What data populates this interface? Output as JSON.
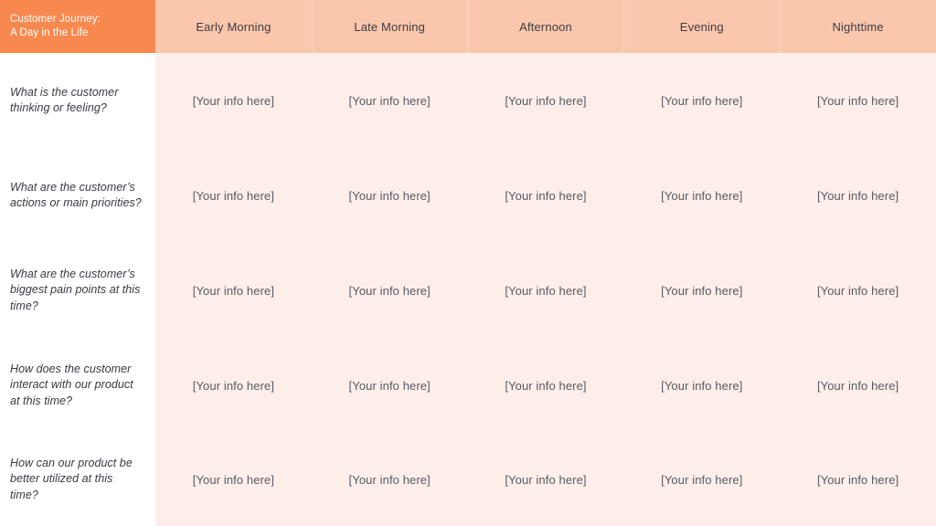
{
  "board": {
    "title_lines": [
      "Customer Journey:",
      "A Day in the Life"
    ],
    "colors": {
      "title_block": "#F8894E",
      "header_band": "#FBC7AC",
      "header_divider": "#FDD5C0",
      "body_cell": "#FDEEEA",
      "label_cell": "#FFFFFF",
      "header_text": "#3C3C41",
      "label_text": "#3A3A40",
      "placeholder_text": "#575B62",
      "title_text": "#FFFFFF"
    },
    "stages": [
      {
        "label": "Early Morning"
      },
      {
        "label": "Late Morning"
      },
      {
        "label": "Afternoon"
      },
      {
        "label": "Evening"
      },
      {
        "label": "Nighttime"
      }
    ],
    "rows": [
      {
        "label": "What is the customer thinking or feeling?",
        "cells": [
          "[Your info here]",
          "[Your info here]",
          "[Your info here]",
          "[Your info here]",
          "[Your info here]"
        ]
      },
      {
        "label": "What are the customer’s actions or main priorities?",
        "cells": [
          "[Your info here]",
          "[Your info here]",
          "[Your info here]",
          "[Your info here]",
          "[Your info here]"
        ]
      },
      {
        "label": "What are the customer’s biggest pain points at this time?",
        "cells": [
          "[Your info here]",
          "[Your info here]",
          "[Your info here]",
          "[Your info here]",
          "[Your info here]"
        ]
      },
      {
        "label": "How does the customer interact with our product at this time?",
        "cells": [
          "[Your info here]",
          "[Your info here]",
          "[Your info here]",
          "[Your info here]",
          "[Your info here]"
        ]
      },
      {
        "label": "How can our product be better utilized at this time?",
        "cells": [
          "[Your info here]",
          "[Your info here]",
          "[Your info here]",
          "[Your info here]",
          "[Your info here]"
        ]
      }
    ]
  }
}
